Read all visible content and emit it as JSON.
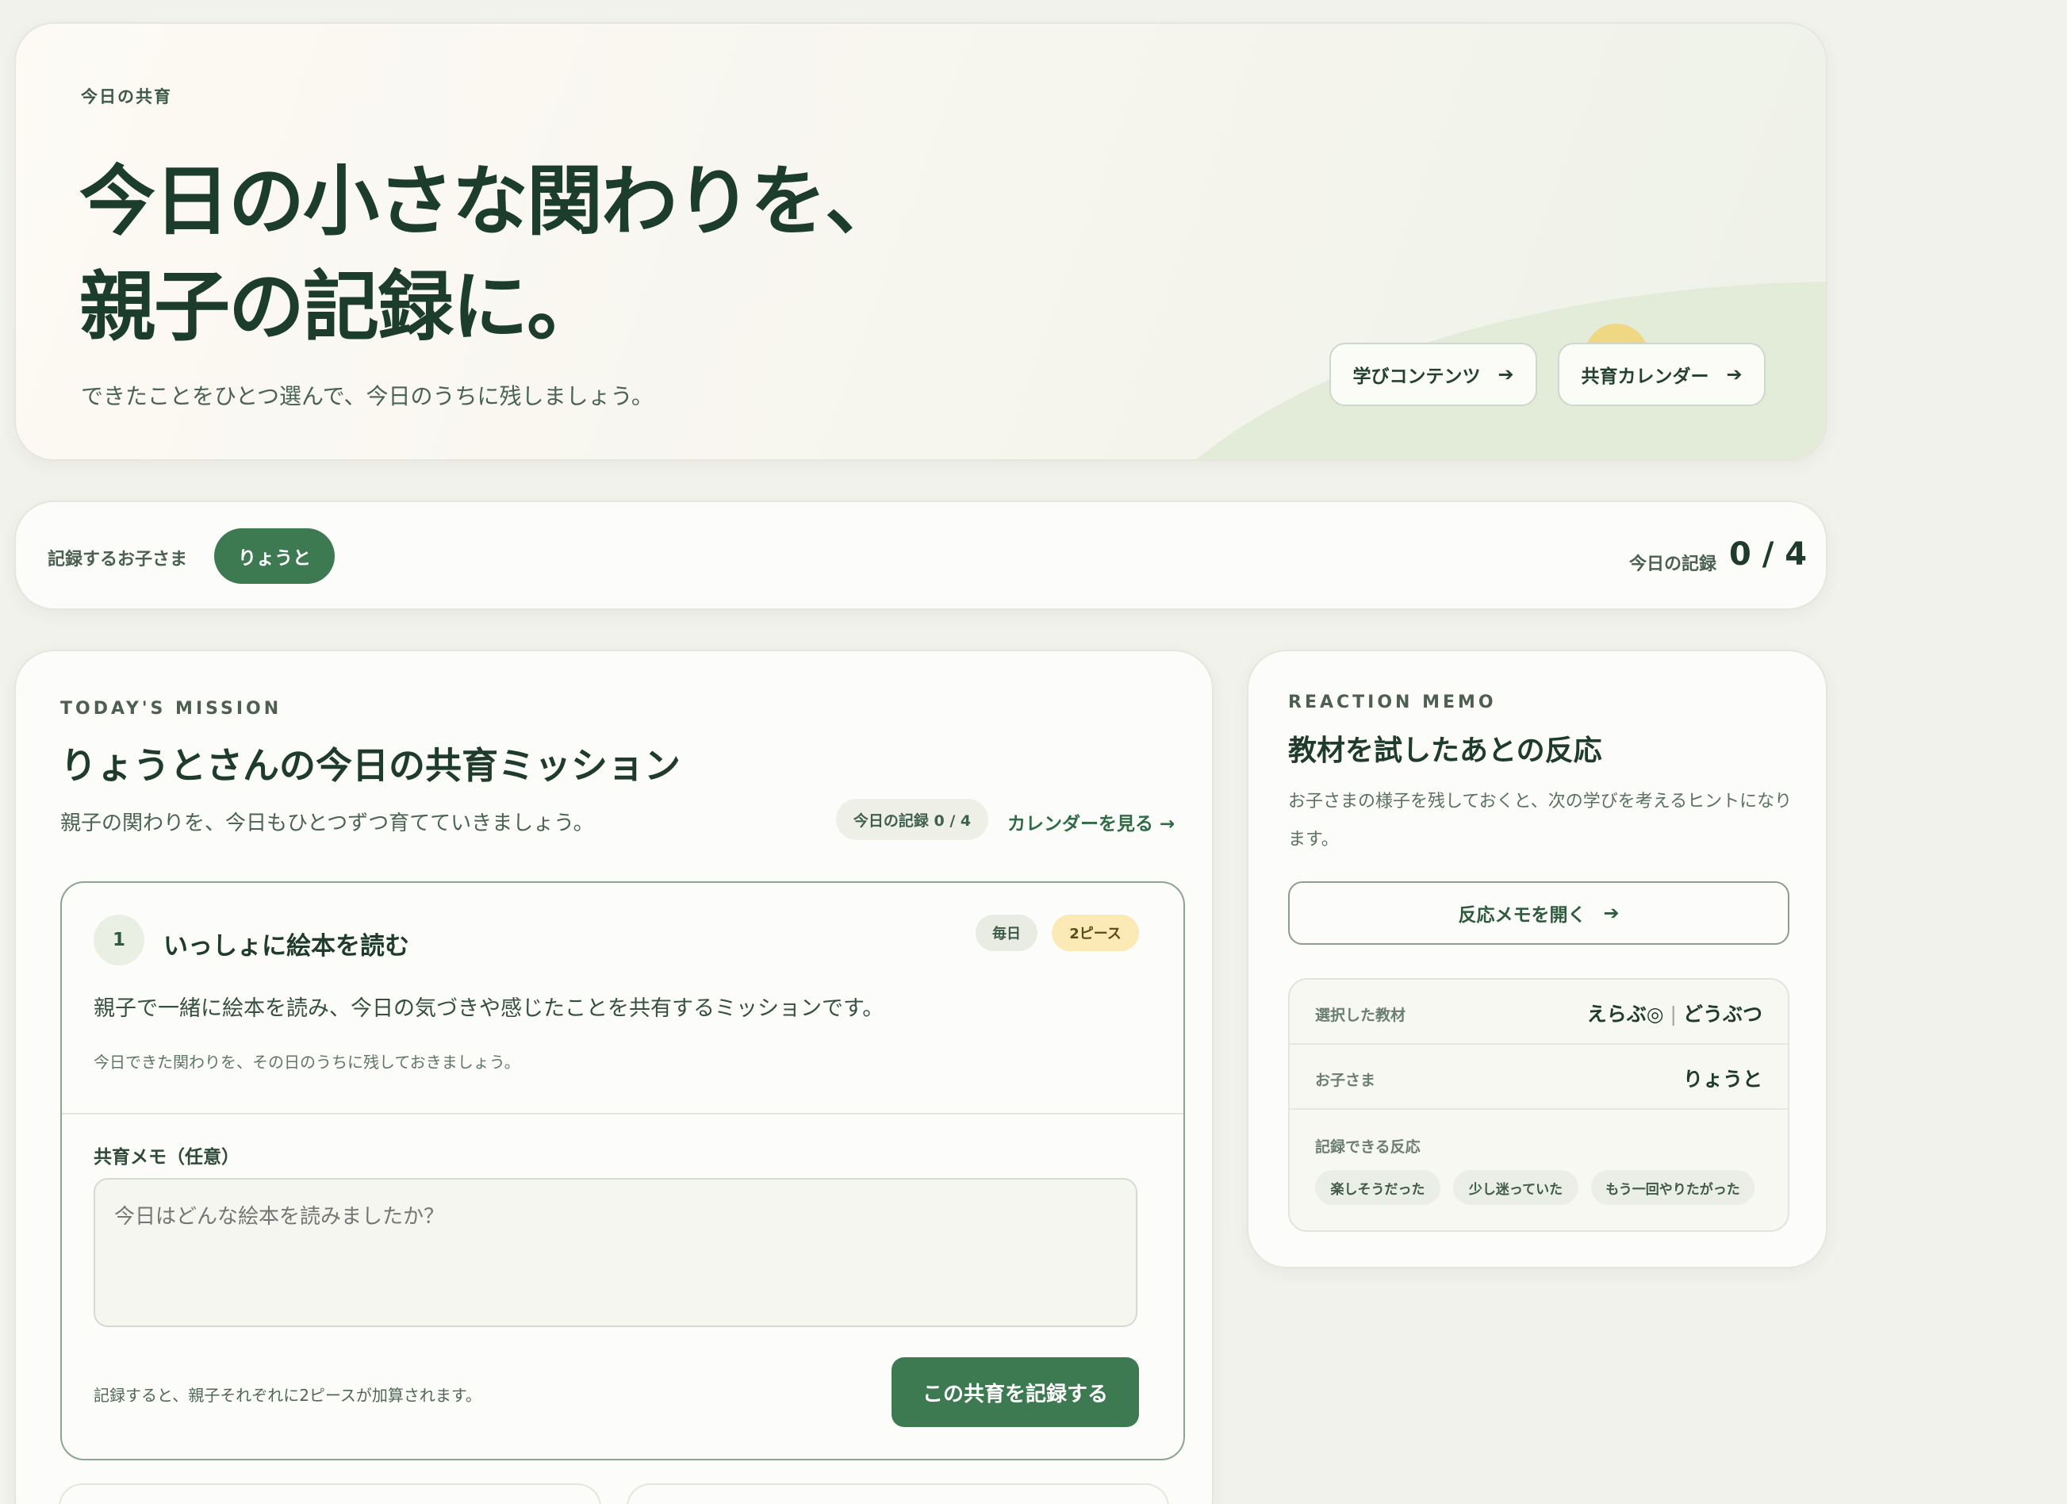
{
  "hero": {
    "eyebrow": "今日の共育",
    "title_line1": "今日の小さな関わりを、",
    "title_line2": "親子の記録に。",
    "subtitle": "できたことをひとつ選んで、今日のうちに残しましょう。",
    "learn_button": "学びコンテンツ",
    "calendar_button": "共育カレンダー",
    "arrow_icon": "arrow-right-icon",
    "hill_color": "#e3ecd8",
    "sun_color": "#f0d57a"
  },
  "child_bar": {
    "label": "記録するお子さま",
    "child_name": "りょうと",
    "record_label": "今日の記録",
    "record_value": "0 / 4"
  },
  "mission": {
    "eyebrow": "TODAY'S MISSION",
    "title": "りょうとさんの今日の共育ミッション",
    "subtitle": "親子の関わりを、今日もひとつずつ育てていきましょう。",
    "count_chip": "今日の記録 0 / 4",
    "calendar_link": "カレンダーを見る →",
    "task": {
      "number": "1",
      "title": "いっしょに絵本を読む",
      "badge_daily": "毎日",
      "badge_pieces": "2ピース",
      "description": "親子で一緒に絵本を読み、今日の気づきや感じたことを共有するミッションです。",
      "note": "今日できた関わりを、その日のうちに残しておきましょう。",
      "memo_label": "共育メモ（任意）",
      "memo_placeholder": "今日はどんな絵本を読みましたか？",
      "footer_note": "記録すると、親子それぞれに2ピースが加算されます。",
      "submit_button": "この共育を記録する"
    }
  },
  "reaction": {
    "eyebrow": "REACTION MEMO",
    "title": "教材を試したあとの反応",
    "description": "お子さまの様子を残しておくと、次の学びを考えるヒントになります。",
    "open_button": "反応メモを開く",
    "selected_material_label": "選択した教材",
    "selected_material_value_a": "えらぶ◎",
    "selected_material_separator": "|",
    "selected_material_value_b": "どうぶつ",
    "child_label": "お子さま",
    "child_value": "りょうと",
    "reactions_label": "記録できる反応",
    "reactions": [
      "楽しそうだった",
      "少し迷っていた",
      "もう一回やりたがった"
    ]
  },
  "colors": {
    "accent_green": "#3d7a52",
    "page_background": "#f2f2ec",
    "badge_yellow": "#fbeab5"
  }
}
